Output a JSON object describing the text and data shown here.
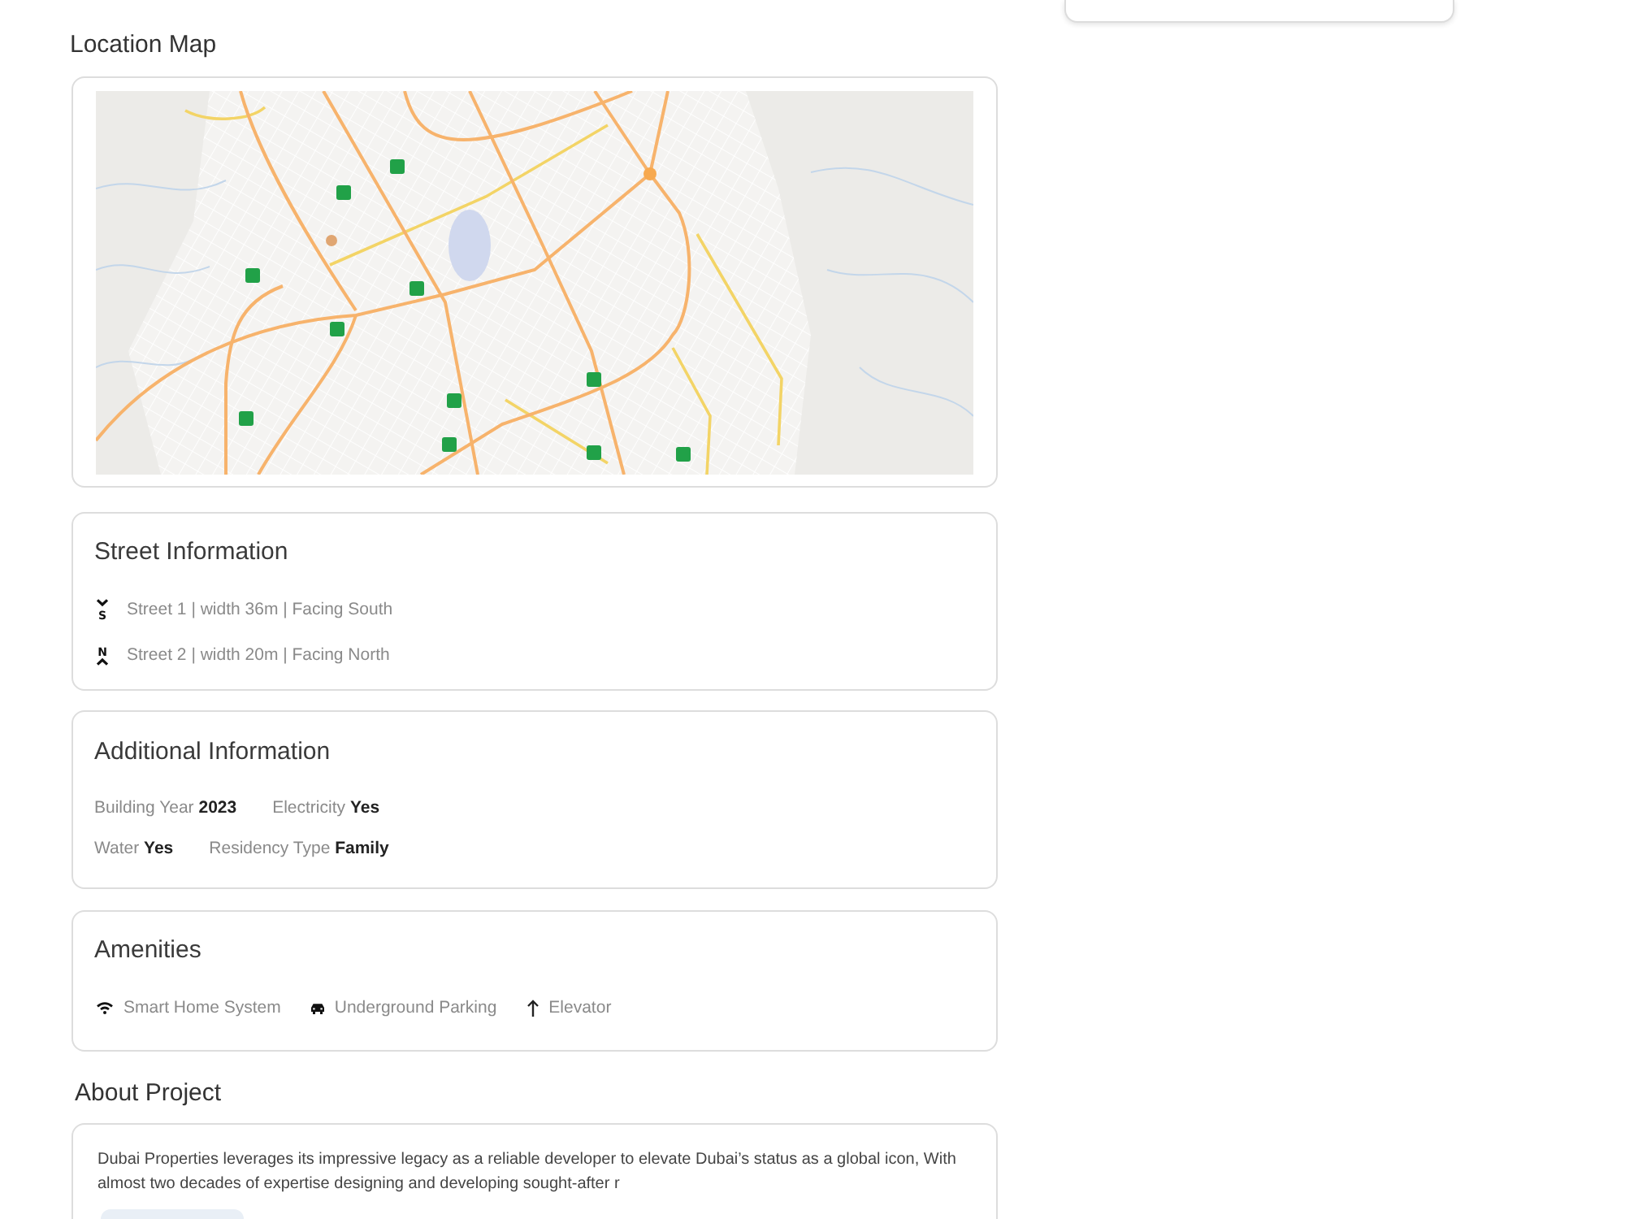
{
  "location_map": {
    "title": "Location Map"
  },
  "street_information": {
    "title": "Street Information",
    "streets": [
      {
        "kind": "south",
        "compass_letter": "S",
        "text": "Street 1 | width 36m | Facing South"
      },
      {
        "kind": "north",
        "compass_letter": "N",
        "text": "Street 2 | width 20m | Facing North"
      }
    ]
  },
  "additional_information": {
    "title": "Additional Information",
    "rows": [
      {
        "items": [
          {
            "text": "Building Year **2023**"
          },
          {
            "text": "Electricity **Yes**"
          }
        ]
      },
      {
        "items": [
          {
            "text": "Water **Yes**"
          },
          {
            "text": "Residency Type **Family**"
          }
        ]
      }
    ]
  },
  "amenities": {
    "title": "Amenities",
    "items": [
      {
        "kind": "wifi",
        "label": "Smart Home System"
      },
      {
        "kind": "car",
        "label": "Underground Parking"
      },
      {
        "kind": "elevator",
        "label": "Elevator"
      }
    ]
  },
  "about_project": {
    "title": "About Project",
    "text": "Dubai Properties leverages its impressive legacy as a reliable developer to elevate Dubai’s status as a global icon, With almost two decades of expertise designing and developing sought-after r"
  }
}
